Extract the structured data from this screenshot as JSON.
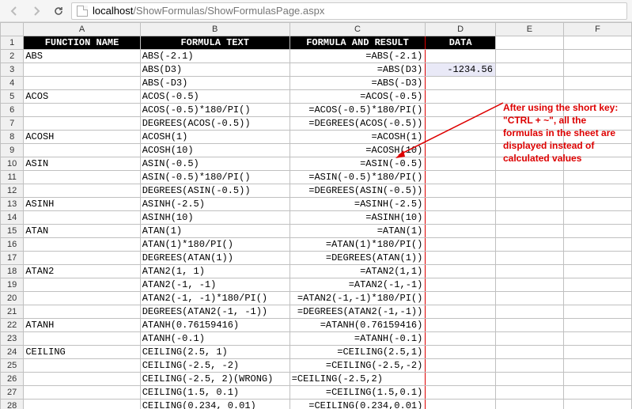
{
  "url": {
    "host": "localhost",
    "path": "/ShowFormulas/ShowFormulasPage.aspx"
  },
  "col_letters": [
    "A",
    "B",
    "C",
    "D",
    "E",
    "F"
  ],
  "headers": {
    "A": "FUNCTION NAME",
    "B": "FORMULA TEXT",
    "C": "FORMULA AND RESULT",
    "D": "DATA"
  },
  "rows": [
    {
      "r": 2,
      "fn": "ABS",
      "ft": "ABS(-2.1)",
      "fr": "=ABS(-2.1)",
      "dt": ""
    },
    {
      "r": 3,
      "fn": "",
      "ft": "ABS(D3)",
      "fr": "=ABS(D3)",
      "dt": "-1234.56",
      "sel": true
    },
    {
      "r": 4,
      "fn": "",
      "ft": "ABS(-D3)",
      "fr": "=ABS(-D3)",
      "dt": ""
    },
    {
      "r": 5,
      "fn": "ACOS",
      "ft": "ACOS(-0.5)",
      "fr": "=ACOS(-0.5)",
      "dt": ""
    },
    {
      "r": 6,
      "fn": "",
      "ft": "ACOS(-0.5)*180/PI()",
      "fr": "=ACOS(-0.5)*180/PI()",
      "dt": ""
    },
    {
      "r": 7,
      "fn": "",
      "ft": "DEGREES(ACOS(-0.5))",
      "fr": "=DEGREES(ACOS(-0.5))",
      "dt": ""
    },
    {
      "r": 8,
      "fn": "ACOSH",
      "ft": "ACOSH(1)",
      "fr": "=ACOSH(1)",
      "dt": ""
    },
    {
      "r": 9,
      "fn": "",
      "ft": "ACOSH(10)",
      "fr": "=ACOSH(10)",
      "dt": ""
    },
    {
      "r": 10,
      "fn": "ASIN",
      "ft": "ASIN(-0.5)",
      "fr": "=ASIN(-0.5)",
      "dt": ""
    },
    {
      "r": 11,
      "fn": "",
      "ft": "ASIN(-0.5)*180/PI()",
      "fr": "=ASIN(-0.5)*180/PI()",
      "dt": ""
    },
    {
      "r": 12,
      "fn": "",
      "ft": "DEGREES(ASIN(-0.5))",
      "fr": "=DEGREES(ASIN(-0.5))",
      "dt": ""
    },
    {
      "r": 13,
      "fn": "ASINH",
      "ft": "ASINH(-2.5)",
      "fr": "=ASINH(-2.5)",
      "dt": ""
    },
    {
      "r": 14,
      "fn": "",
      "ft": "ASINH(10)",
      "fr": "=ASINH(10)",
      "dt": ""
    },
    {
      "r": 15,
      "fn": "ATAN",
      "ft": "ATAN(1)",
      "fr": "=ATAN(1)",
      "dt": ""
    },
    {
      "r": 16,
      "fn": "",
      "ft": "ATAN(1)*180/PI()",
      "fr": "=ATAN(1)*180/PI()",
      "dt": ""
    },
    {
      "r": 17,
      "fn": "",
      "ft": "DEGREES(ATAN(1))",
      "fr": "=DEGREES(ATAN(1))",
      "dt": ""
    },
    {
      "r": 18,
      "fn": "ATAN2",
      "ft": "ATAN2(1, 1)",
      "fr": "=ATAN2(1,1)",
      "dt": ""
    },
    {
      "r": 19,
      "fn": "",
      "ft": "ATAN2(-1, -1)",
      "fr": "=ATAN2(-1,-1)",
      "dt": ""
    },
    {
      "r": 20,
      "fn": "",
      "ft": "ATAN2(-1, -1)*180/PI()",
      "fr": "=ATAN2(-1,-1)*180/PI()",
      "dt": ""
    },
    {
      "r": 21,
      "fn": "",
      "ft": "DEGREES(ATAN2(-1, -1))",
      "fr": "=DEGREES(ATAN2(-1,-1))",
      "dt": ""
    },
    {
      "r": 22,
      "fn": "ATANH",
      "ft": "ATANH(0.76159416)",
      "fr": "=ATANH(0.76159416)",
      "dt": ""
    },
    {
      "r": 23,
      "fn": "",
      "ft": "ATANH(-0.1)",
      "fr": "=ATANH(-0.1)",
      "dt": ""
    },
    {
      "r": 24,
      "fn": "CEILING",
      "ft": "CEILING(2.5, 1)",
      "fr": "=CEILING(2.5,1)",
      "dt": ""
    },
    {
      "r": 25,
      "fn": "",
      "ft": "CEILING(-2.5, -2)",
      "fr": "=CEILING(-2.5,-2)",
      "dt": ""
    },
    {
      "r": 26,
      "fn": "",
      "ft": "CEILING(-2.5, 2)(WRONG)",
      "fr": "=CEILING(-2.5,2)",
      "dt": "",
      "fr_align": "left"
    },
    {
      "r": 27,
      "fn": "",
      "ft": "CEILING(1.5, 0.1)",
      "fr": "=CEILING(1.5,0.1)",
      "dt": ""
    },
    {
      "r": 28,
      "fn": "",
      "ft": "CEILING(0.234, 0.01)",
      "fr": "=CEILING(0.234,0.01)",
      "dt": ""
    }
  ],
  "annotation": "After using the short key: \"CTRL + ~\", all the formulas in the sheet are displayed instead of calculated values"
}
